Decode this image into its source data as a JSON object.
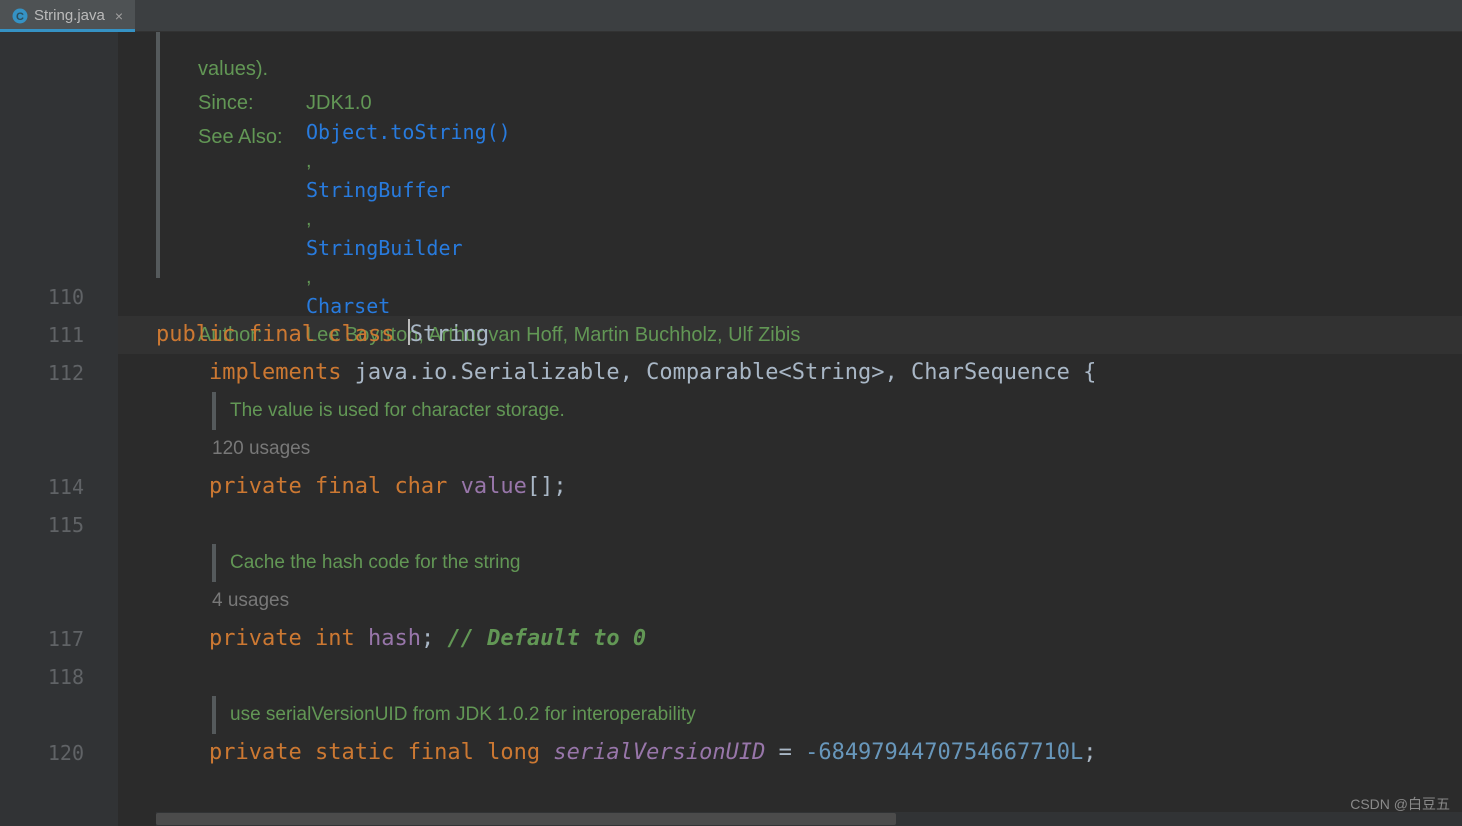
{
  "tab": {
    "label": "String.java"
  },
  "doc": {
    "tailLine": "values).",
    "since_label": "Since:",
    "since_value": "JDK1.0",
    "seealso_label": "See Also:",
    "links": [
      "Object.toString()",
      "StringBuffer",
      "StringBuilder",
      "Charset"
    ],
    "author_label": "Author:",
    "author_value": "Lee Boynton, Arthur van Hoff, Martin Buchholz, Ulf Zibis"
  },
  "lines": {
    "n110": "110",
    "n111": "111",
    "n112": "112",
    "n114": "114",
    "n115": "115",
    "n117": "117",
    "n118": "118",
    "n120": "120"
  },
  "code": {
    "l111": {
      "kw1": "public",
      "kw2": "final",
      "kw3": "class",
      "name": "String"
    },
    "l112": {
      "kw": "implements",
      "rest": "java.io.Serializable, Comparable<String>, CharSequence {"
    },
    "doc_value": "The value is used for character storage.",
    "usages_value": "120 usages",
    "l114": {
      "kw1": "private",
      "kw2": "final",
      "kw3": "char",
      "field": "value",
      "tail": "[];"
    },
    "doc_hash": "Cache the hash code for the string",
    "usages_hash": "4 usages",
    "l117": {
      "kw1": "private",
      "kw2": "int",
      "field": "hash",
      "tail": "; ",
      "cmt": "// Default to 0"
    },
    "doc_serial": "use serialVersionUID from JDK 1.0.2 for interoperability",
    "l120": {
      "kw1": "private",
      "kw2": "static",
      "kw3": "final",
      "kw4": "long",
      "field": "serialVersionUID",
      "eq": " = ",
      "num": "-6849794470754667710L",
      "tail": ";"
    }
  },
  "watermark": "CSDN @白豆五"
}
